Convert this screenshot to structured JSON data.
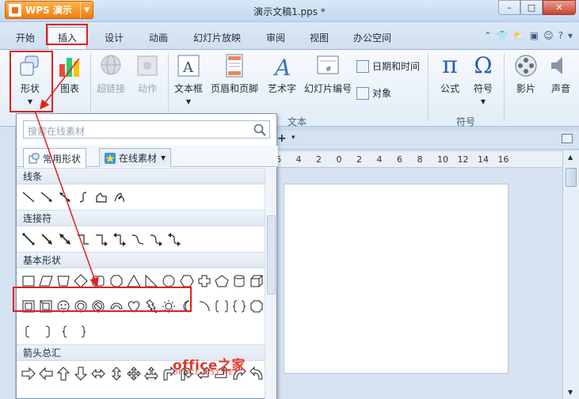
{
  "window": {
    "app_button": "WPS 演示",
    "doc_title": "演示文稿1.pps *",
    "minimize": "–",
    "maximize": "□",
    "close": "✕"
  },
  "menu": {
    "tabs": [
      "开始",
      "插入",
      "设计",
      "动画",
      "幻灯片放映",
      "审阅",
      "视图",
      "办公空间"
    ],
    "active": "插入"
  },
  "ribbon": {
    "shape": "形状",
    "chart": "图表",
    "hyperlink": "超链接",
    "action": "动作",
    "textbox": "文本框",
    "header_footer": "页眉和页脚",
    "wordart": "艺术字",
    "slide_number": "幻灯片编号",
    "datetime": "日期和时间",
    "object": "对象",
    "formula": "公式",
    "symbol": "符号",
    "movie": "影片",
    "sound": "声音",
    "group_text": "文本",
    "group_symbol": "符号"
  },
  "ruler": {
    "ticks": [
      "6",
      "4",
      "2",
      "0",
      "2",
      "4",
      "6",
      "8",
      "10",
      "12",
      "14",
      "16"
    ]
  },
  "panel": {
    "search_placeholder": "搜索在线素材",
    "tab_common": "常用形状",
    "tab_online": "在线素材",
    "categories": [
      "线条",
      "连接符",
      "基本形状",
      "箭头总汇"
    ]
  },
  "watermark": {
    "main": "office之家",
    "sub": "OFFICE.JB51.NET"
  },
  "colors": {
    "accent": "#e0201b",
    "wps_orange": "#f07d10",
    "ribbon_bg": "#e2ecf7"
  }
}
